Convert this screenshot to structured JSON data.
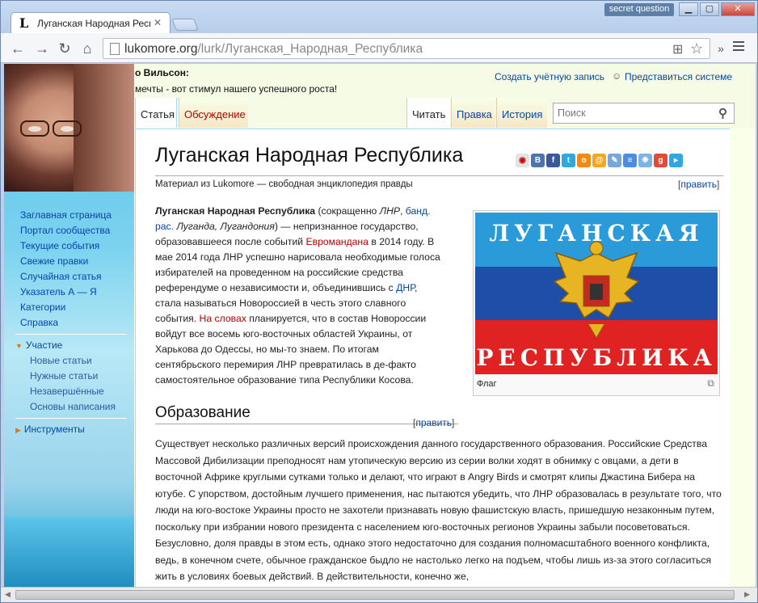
{
  "browser": {
    "tab_title": "Луганская Народная Респ",
    "tab_favicon": "L",
    "secret_question": "secret question",
    "url_host": "lukomore.org",
    "url_path": "/lurk/Луганская_Народная_Республика"
  },
  "header": {
    "who": "о Вильсон:",
    "motto": "мечты - вот стимул нашего успешного роста!",
    "create_account": "Создать учётную запись",
    "login": "Представиться системе",
    "tab_article": "Статья",
    "tab_talk": "Обсуждение",
    "tab_read": "Читать",
    "tab_edit": "Правка",
    "tab_history": "История",
    "search_placeholder": "Поиск"
  },
  "sidebar": {
    "nav": [
      "Заглавная страница",
      "Портал сообщества",
      "Текущие события",
      "Свежие правки",
      "Случайная статья",
      "Указатель А — Я",
      "Категории",
      "Справка"
    ],
    "participation": "Участие",
    "participation_items": [
      "Новые статьи",
      "Нужные статьи",
      "Незавершённые",
      "Основы написания"
    ],
    "tools": "Инструменты"
  },
  "article": {
    "title": "Луганская Народная Республика",
    "subtitle": "Материал из Lukomore — свободная энциклопедия правды",
    "edit_label": "править",
    "flag_top": "ЛУГАНСКАЯ",
    "flag_bottom": "РЕСПУБЛИКА",
    "caption": "Флаг",
    "section": "Образование",
    "lead": {
      "b1": "Луганская Народная Республика",
      "t1": " (сокращенно ",
      "i1": "ЛНР",
      "t2": ", ",
      "a1": "банд. рас.",
      "t3": " ",
      "i2": "Луганда, Лугандония",
      "t4": ") — непризнанное государство, образовавшееся после событий ",
      "a2": "Евромандана",
      "t5": " в 2014 году. В мае 2014 года ЛНР успешно нарисовала необходимые голоса избирателей на проведенном на российские средства референдуме о независимости и, объединившись с ",
      "a3": "ДНР",
      "t6": ", стала называться Новороссией в честь этого славного события. ",
      "a4": "На словах",
      "t7": " планируется, что в состав Новороссии войдут все восемь юго-восточных областей Украины, от Харькова до Одессы, но мы-то знаем. По итогам сентябрьского перемирия ЛНР превратилась в де-факто самостоятельное образование типа Республики Косова."
    },
    "body": "Существует несколько различных версий происхождения данного государственного образования. Российские Средства Массовой Дибилизации преподносят нам утопическую версию из серии волки ходят в обнимку с овцами, а дети в восточной Африке круглыми сутками только и делают, что играют в Angry Birds и смотрят клипы Джастина Бибера на ютубе. С упорством, достойным лучшего применения, нас пытаются убедить, что ЛНР образовалась в результате того, что люди на юго-востоке Украины просто не захотели признавать новую фашистскую власть, пришедшую незаконным путем, поскольку при избрании нового президента с населением юго-восточных регионов Украины забыли посоветоваться. Безусловно, доля правды в этом есть, однако этого недостаточно для создания полномасштабного военного конфликта, ведь, в конечном счете, обычное гражданское быдло не настолько легко на подъем, чтобы лишь из-за этого согласиться жить в условиях боевых действий. В действительности, конечно же,"
  },
  "colors": {
    "link": "#0645ad",
    "redlink": "#ba0000",
    "accent": "#d97a14"
  }
}
